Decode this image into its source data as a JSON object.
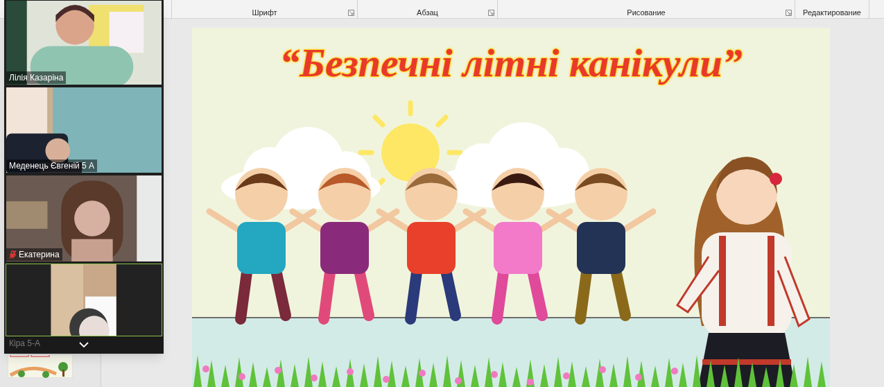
{
  "ribbon": {
    "groups": [
      {
        "label": "Шрифт",
        "launcher": true
      },
      {
        "label": "Абзац",
        "launcher": true
      },
      {
        "label": "Рисование",
        "launcher": true
      },
      {
        "label": "Редактирование",
        "launcher": false
      }
    ]
  },
  "video_panel": {
    "participants": [
      {
        "name": "Лілія Казаріна",
        "muted": false,
        "speaking": false,
        "kind": "picture"
      },
      {
        "name": "Меденець Євгеній 5 А",
        "muted": false,
        "speaking": false,
        "kind": "picture"
      },
      {
        "name": "Екатерина",
        "muted": true,
        "speaking": false,
        "kind": "picture"
      },
      {
        "name": "Кіра 5-А",
        "muted": false,
        "speaking": true,
        "kind": "picture"
      }
    ]
  },
  "slide": {
    "title": "“Безпечні літні канікули”"
  }
}
